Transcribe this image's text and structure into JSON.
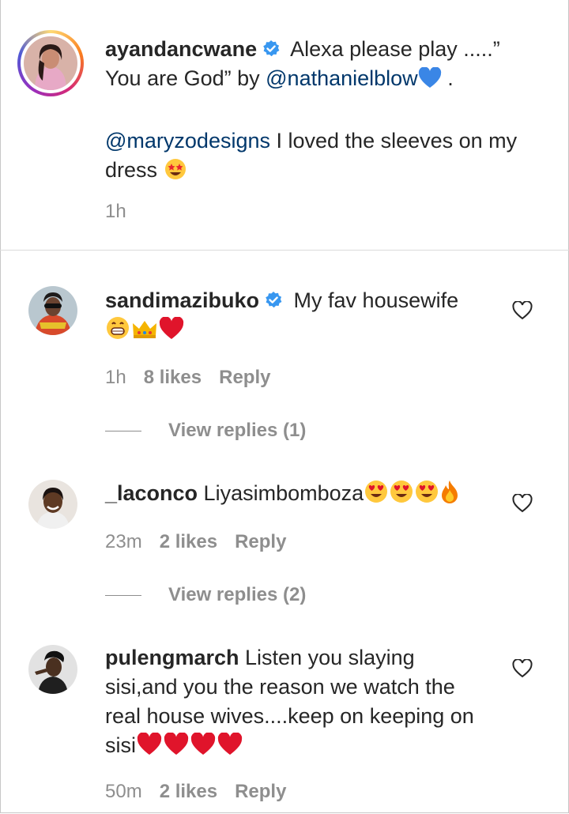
{
  "caption": {
    "username": "ayandancwane",
    "text_line1": " Alexa please play .....”",
    "text_line2_pre": "You are God” by ",
    "mention1": "@nathanielblow",
    "text_line2_post": " .",
    "mention2": "@maryzodesigns",
    "text_line3_post": " I loved the sleeves on my",
    "text_line4": "dress",
    "time": "1h"
  },
  "comments": [
    {
      "username": "sandimazibuko",
      "text": " My fav housewife",
      "time": "1h",
      "likes": "8 likes",
      "reply": "Reply",
      "view_replies": "View replies (1)"
    },
    {
      "username": "_laconco",
      "text": " Liyasimbomboza",
      "time": "23m",
      "likes": "2 likes",
      "reply": "Reply",
      "view_replies": "View replies (2)"
    },
    {
      "username": "pulengmarch",
      "text_line1": " Listen you slaying",
      "text_line2": "sisi,and you the reason we watch the",
      "text_line3": "real house wives....keep on keeping on",
      "text_line4": "sisi",
      "time": "50m",
      "likes": "2 likes",
      "reply": "Reply"
    }
  ],
  "colors": {
    "verified": "#3897f0",
    "mention": "#00376b",
    "meta": "#8e8e8e",
    "heart_red": "#e0142b"
  }
}
